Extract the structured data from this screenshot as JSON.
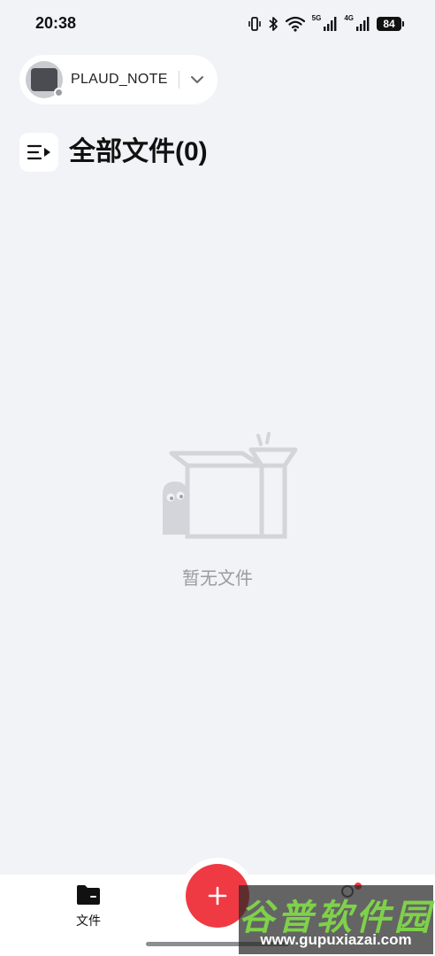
{
  "status_bar": {
    "time": "20:38",
    "network_5g": "5G",
    "network_4g": "4G",
    "battery": "84"
  },
  "device": {
    "name": "PLAUD_NOTE"
  },
  "header": {
    "title": "全部文件(0)"
  },
  "empty_state": {
    "text": "暂无文件"
  },
  "bottom_nav": {
    "files_label": "文件",
    "accent_color": "#ef3a43"
  },
  "watermark": {
    "title": "谷普软件园",
    "url": "www.gupuxiazai.com"
  }
}
